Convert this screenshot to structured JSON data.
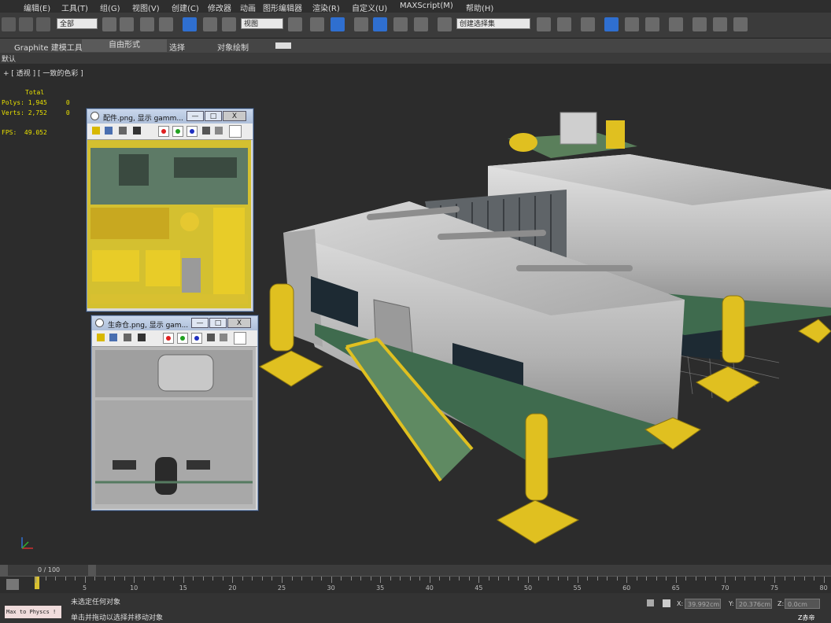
{
  "menu": [
    "编辑(E)",
    "工具(T)",
    "组(G)",
    "视图(V)",
    "创建(C)",
    "修改器",
    "动画",
    "图形编辑器",
    "渲染(R)",
    "自定义(U)",
    "MAXScript(M)",
    "帮助(H)"
  ],
  "toolbar": {
    "selection_filter": "全部",
    "ref_coord": "视图",
    "named_selection": "创建选择集"
  },
  "ribbon": {
    "tabs": [
      "Graphite 建模工具",
      "自由形式",
      "选择",
      "对象绘制"
    ],
    "active_tab": "自由形式",
    "sub": "默认"
  },
  "viewport": {
    "label": "+ [ 透视 ] [ 一致的色彩 ]",
    "stats": {
      "total_header": "Total",
      "polys_label": "Polys:",
      "polys_value": "1,945",
      "polys_sel": "0",
      "verts_label": "Verts:",
      "verts_value": "2,752",
      "verts_sel": "0",
      "fps_label": "FPS:",
      "fps_value": "49.052"
    }
  },
  "map_windows": [
    {
      "title": "配件.png, 显示 gamm..."
    },
    {
      "title": "生命仓.png, 显示 gam..."
    }
  ],
  "window_buttons": {
    "min": "—",
    "max": "□",
    "close": "X"
  },
  "timeline": {
    "frame": "0 / 100"
  },
  "ruler": {
    "marks": [
      "5",
      "10",
      "15",
      "20",
      "25",
      "30",
      "35",
      "40",
      "45",
      "50",
      "55",
      "60",
      "65",
      "70",
      "75",
      "80"
    ]
  },
  "status": {
    "line1": "未选定任何对象",
    "line2": "单击并拖动以选择并移动对象",
    "listener": "Max to Physcs !",
    "x_label": "X:",
    "x_value": "39.992cm",
    "y_label": "Y:",
    "y_value": "20.376cm",
    "z_label": "Z:",
    "z_value": "0.0cm",
    "watermark": "Z赤帝"
  }
}
